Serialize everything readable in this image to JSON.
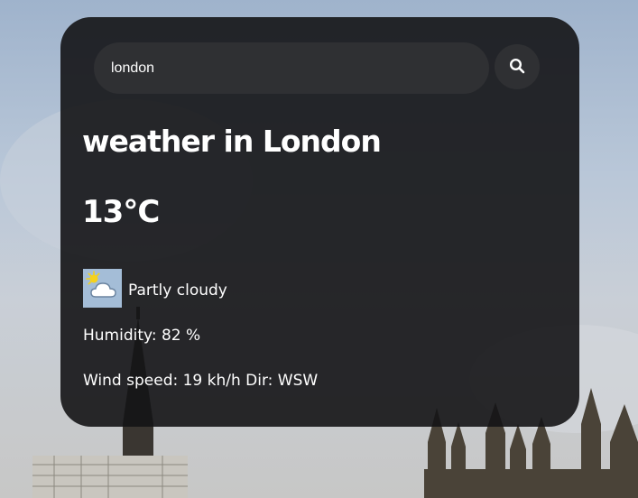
{
  "search": {
    "value": "london",
    "icon": "search-icon"
  },
  "weather": {
    "title": "weather in London",
    "temperature": "13°C",
    "condition": "Partly cloudy",
    "condition_icon": "partly-cloudy-icon",
    "humidity": "Humidity: 82 %",
    "wind": "Wind speed: 19 kh/h Dir: WSW"
  },
  "colors": {
    "card_background": "#141416",
    "input_background": "#2f3033",
    "text": "#ffffff"
  }
}
